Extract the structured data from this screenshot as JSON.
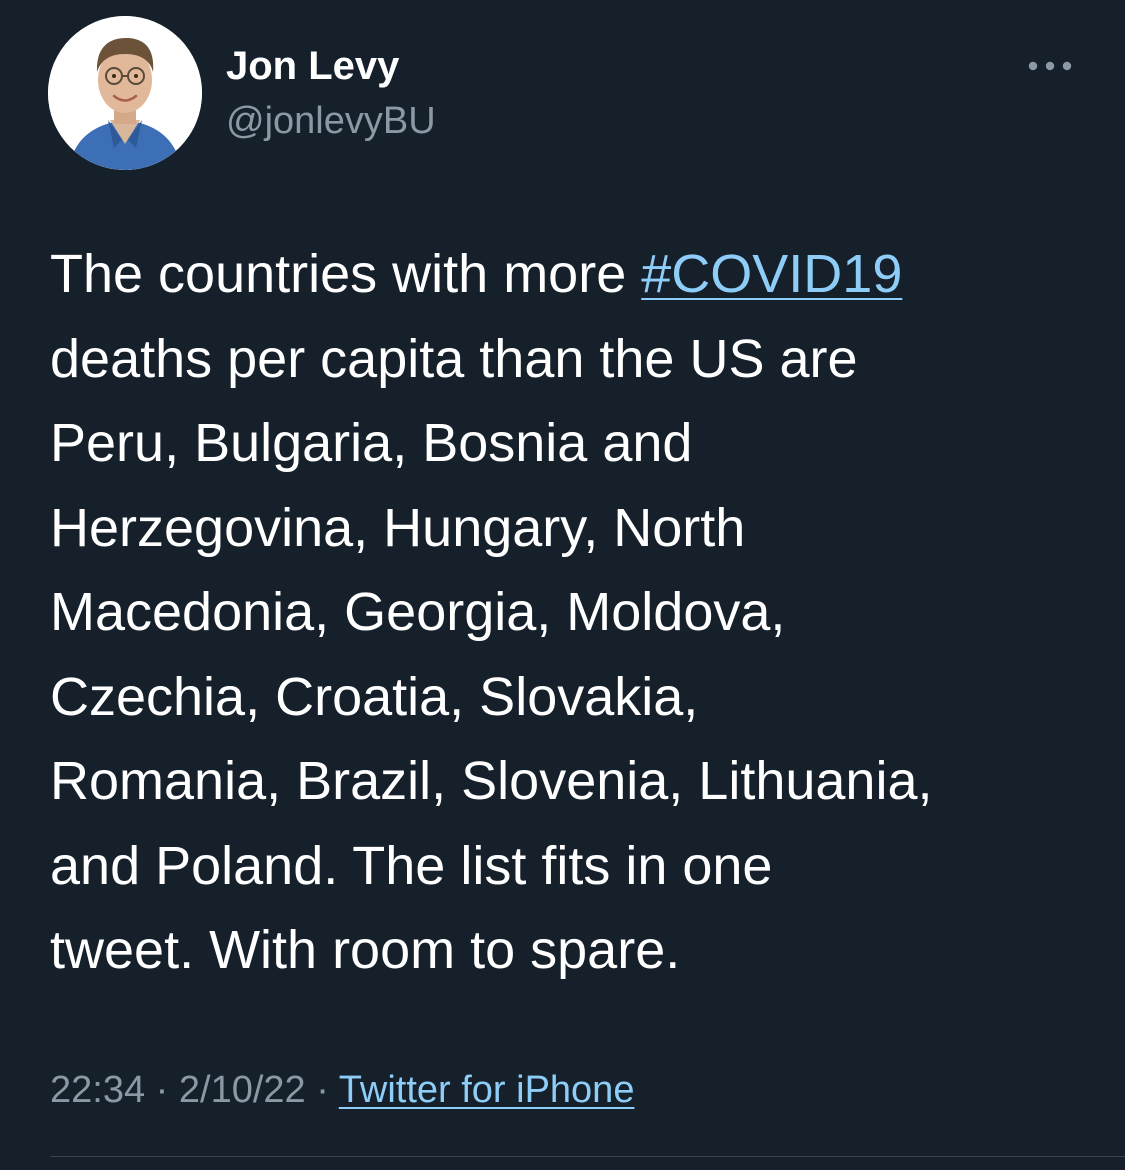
{
  "author": {
    "display_name": "Jon Levy",
    "handle": "@jonlevyBU",
    "avatar_icon": "profile-photo"
  },
  "more_icon": "more-horizontal-icon",
  "tweet": {
    "lines": [
      {
        "before": "The countries with more ",
        "hashtag": "#COVID19"
      },
      {
        "text": "deaths per capita than the US are"
      },
      {
        "text": "Peru, Bulgaria, Bosnia and"
      },
      {
        "text": "Herzegovina, Hungary, North"
      },
      {
        "text": "Macedonia, Georgia, Moldova,"
      },
      {
        "text": "Czechia, Croatia, Slovakia,"
      },
      {
        "text": "Romania, Brazil, Slovenia, Lithuania,"
      },
      {
        "text": "and Poland. The list fits in one"
      },
      {
        "text": "tweet. With room to spare."
      }
    ]
  },
  "meta": {
    "time": "22:34",
    "separator": "·",
    "date": "2/10/22",
    "source": "Twitter for iPhone"
  },
  "colors": {
    "background": "#15202b",
    "text": "#ffffff",
    "secondary": "#8b98a5",
    "link": "#8ecdf8",
    "divider": "#38444d"
  }
}
